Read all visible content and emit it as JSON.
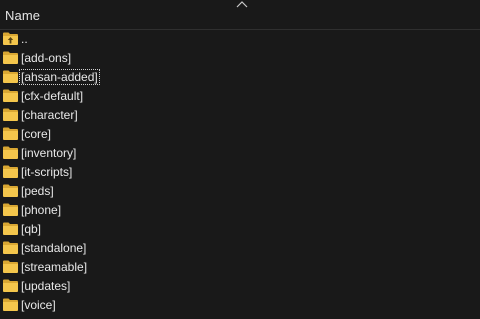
{
  "window": {
    "column_header": "Name",
    "sort_indicator_icon": "chevron-up-icon"
  },
  "items": [
    {
      "label": "..",
      "icon": "folder-up-icon"
    },
    {
      "label": "[add-ons]",
      "icon": "folder-icon"
    },
    {
      "label": "[ahsan-added]",
      "icon": "folder-icon",
      "focused": true
    },
    {
      "label": "[cfx-default]",
      "icon": "folder-icon"
    },
    {
      "label": "[character]",
      "icon": "folder-icon"
    },
    {
      "label": "[core]",
      "icon": "folder-icon"
    },
    {
      "label": "[inventory]",
      "icon": "folder-icon"
    },
    {
      "label": "[it-scripts]",
      "icon": "folder-icon"
    },
    {
      "label": "[peds]",
      "icon": "folder-icon"
    },
    {
      "label": "[phone]",
      "icon": "folder-icon"
    },
    {
      "label": "[qb]",
      "icon": "folder-icon"
    },
    {
      "label": "[standalone]",
      "icon": "folder-icon"
    },
    {
      "label": "[streamable]",
      "icon": "folder-icon"
    },
    {
      "label": "[updates]",
      "icon": "folder-icon"
    },
    {
      "label": "[voice]",
      "icon": "folder-icon"
    }
  ],
  "colors": {
    "background": "#191919",
    "text": "#e8e8e8",
    "folder": "#f3c549"
  }
}
